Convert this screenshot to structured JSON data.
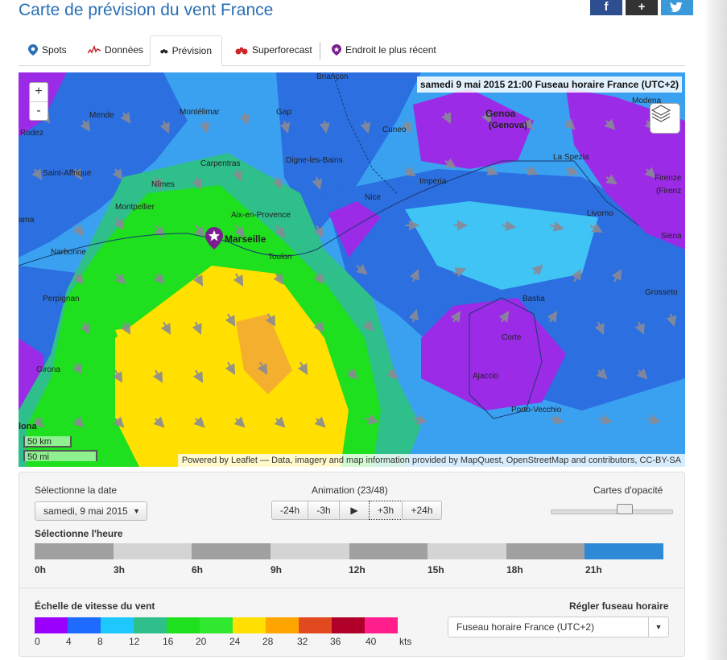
{
  "page_title": "Carte de prévision du vent France",
  "social": [
    "f",
    "+",
    "tw"
  ],
  "tabs": [
    {
      "label": "Spots",
      "icon": "spot-icon"
    },
    {
      "label": "Données",
      "icon": "data-chart-icon"
    },
    {
      "label": "Prévision",
      "icon": "binoculars-icon",
      "active": true
    },
    {
      "label": "Superforecast",
      "icon": "binoculars-red-icon"
    },
    {
      "label": "Endroit le plus récent",
      "icon": "star-pin-icon"
    }
  ],
  "map": {
    "timestamp": "samedi 9 mai 2015 21:00 Fuseau horaire France (UTC+2)",
    "zoom_in": "+",
    "zoom_out": "-",
    "scale_km": "50 km",
    "scale_mi": "50 mi",
    "attribution": "Powered by Leaflet — Data, imagery and map information provided by MapQuest, OpenStreetMap and contributors, CC-BY-SA",
    "places": [
      "Briançon",
      "Montélimar",
      "Mende",
      "Gap",
      "Cuneo",
      "Rodez",
      "Carpentras",
      "Digne-les-Bains",
      "Saint-Affrique",
      "Nîmes",
      "Montpellier",
      "Aix-en-Provence",
      "Nice",
      "Imperia",
      "Marseille",
      "Toulon",
      "Narbonne",
      "Perpignan",
      "Genoa",
      "(Genova)",
      "La Spezia",
      "Modena",
      "Livorno",
      "Firenze",
      "(Firenz",
      "Siena",
      "Grosseto",
      "Bastia",
      "Corte",
      "Ajaccio",
      "Porto-Vecchio",
      "Girona",
      "ama",
      "lona"
    ]
  },
  "controls": {
    "date_label": "Sélectionne la date",
    "date_value": "samedi, 9 mai 2015",
    "animation_label": "Animation (23/48)",
    "anim_buttons": [
      "-24h",
      "-3h",
      "▶",
      "+3h",
      "+24h"
    ],
    "opacity_label": "Cartes d'opacité",
    "hour_label": "Sélectionne l'heure",
    "hours": [
      "0h",
      "3h",
      "6h",
      "9h",
      "12h",
      "15h",
      "18h",
      "21h"
    ],
    "selected_hour": "21h",
    "scale_label": "Échelle de vitesse du vent",
    "scale_colors": [
      "#9b00ff",
      "#1e6cff",
      "#1ec8ff",
      "#2fbf8a",
      "#1ee01e",
      "#30e830",
      "#ffe000",
      "#ffa500",
      "#e04a1e",
      "#b0002a",
      "#ff1e8c"
    ],
    "scale_ticks": [
      "0",
      "4",
      "8",
      "12",
      "16",
      "20",
      "24",
      "28",
      "32",
      "36",
      "40"
    ],
    "scale_unit": "kts",
    "tz_label": "Régler fuseau horaire",
    "tz_value": "Fuseau horaire France (UTC+2)"
  }
}
